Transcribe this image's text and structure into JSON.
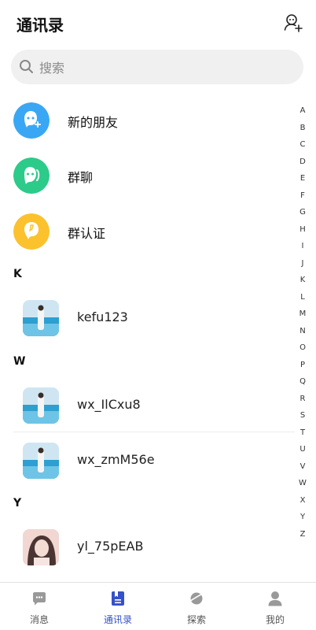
{
  "header": {
    "title": "通讯录"
  },
  "search": {
    "placeholder": "搜索",
    "value": ""
  },
  "functions": [
    {
      "label": "新的朋友",
      "color": "#3aa7f5"
    },
    {
      "label": "群聊",
      "color": "#2ccb8a"
    },
    {
      "label": "群认证",
      "color": "#fbc22e"
    }
  ],
  "sections": [
    {
      "letter": "K",
      "contacts": [
        {
          "name": "kefu123",
          "avatar": "beach-photo"
        }
      ]
    },
    {
      "letter": "W",
      "contacts": [
        {
          "name": "wx_IlCxu8",
          "avatar": "beach-photo"
        },
        {
          "name": "wx_zmM56e",
          "avatar": "beach-photo"
        }
      ]
    },
    {
      "letter": "Y",
      "contacts": [
        {
          "name": "yl_75pEAB",
          "avatar": "portrait-photo"
        }
      ]
    }
  ],
  "index_letters": [
    "A",
    "B",
    "C",
    "D",
    "E",
    "F",
    "G",
    "H",
    "I",
    "J",
    "K",
    "L",
    "M",
    "N",
    "O",
    "P",
    "Q",
    "R",
    "S",
    "T",
    "U",
    "V",
    "W",
    "X",
    "Y",
    "Z"
  ],
  "tabs": [
    {
      "label": "消息",
      "icon": "chat-icon",
      "active": false
    },
    {
      "label": "通讯录",
      "icon": "contacts-icon",
      "active": true
    },
    {
      "label": "探索",
      "icon": "planet-icon",
      "active": false
    },
    {
      "label": "我的",
      "icon": "person-icon",
      "active": false
    }
  ],
  "colors": {
    "accent": "#3451c7",
    "inactive_tab": "#999999"
  }
}
